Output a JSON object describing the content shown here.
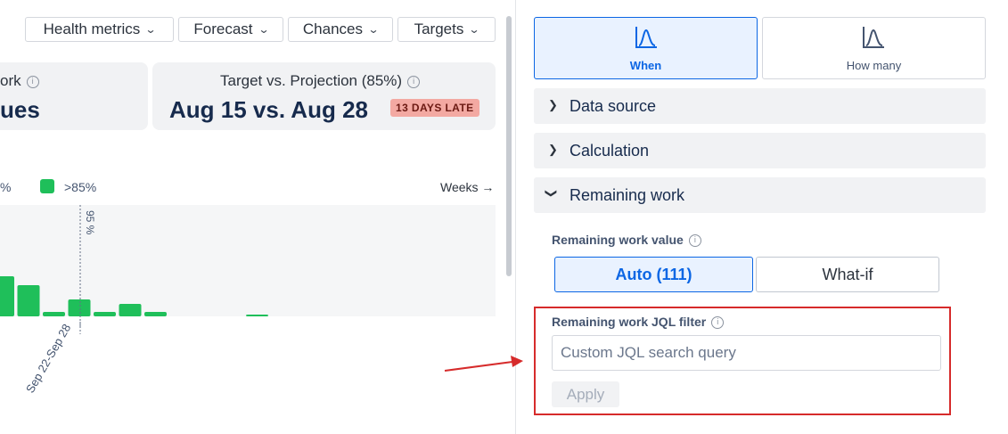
{
  "toolbar": {
    "health_metrics": "Health metrics",
    "forecast": "Forecast",
    "chances": "Chances",
    "targets": "Targets"
  },
  "cards": {
    "left": {
      "title": "ork",
      "value": "ues"
    },
    "right": {
      "title": "Target vs. Projection (85%)",
      "value": "Aug 15 vs. Aug 28",
      "badge": "13 DAYS LATE"
    }
  },
  "chart": {
    "legend_left_fragment": "%",
    "legend_label": ">85%",
    "weeks_link": "Weeks →",
    "marker_label": "95 %",
    "x_tick_label": "Sep 22-Sep 28"
  },
  "chart_data": {
    "type": "bar",
    "title": "",
    "series": [
      {
        "name": ">85%",
        "color": "#1fbf5a",
        "values": [
          45,
          35,
          5,
          19,
          5,
          14,
          5,
          0,
          0,
          0,
          2
        ]
      }
    ],
    "x_tick_labels": [
      "Sep 22-Sep 28"
    ],
    "marker": "95 %"
  },
  "panel": {
    "modes": [
      {
        "label": "When",
        "active": true
      },
      {
        "label": "How many",
        "active": false
      }
    ],
    "sections": [
      {
        "label": "Data source",
        "expanded": false
      },
      {
        "label": "Calculation",
        "expanded": false
      },
      {
        "label": "Remaining work",
        "expanded": true
      }
    ],
    "remaining_work_value_label": "Remaining work value",
    "auto_option": "Auto (111)",
    "whatif_option": "What-if",
    "jql_label": "Remaining work JQL filter",
    "jql_placeholder": "Custom JQL search query",
    "jql_value": "",
    "apply_label": "Apply"
  },
  "colors": {
    "accent": "#0c66e4",
    "success": "#1fbf5a",
    "danger": "#d62b2b",
    "badge_bg": "#f3a9a2"
  },
  "icons": {
    "mode_icon": "distribution-curve-icon",
    "info": "info-icon",
    "chevron": "chevron-down-icon"
  }
}
